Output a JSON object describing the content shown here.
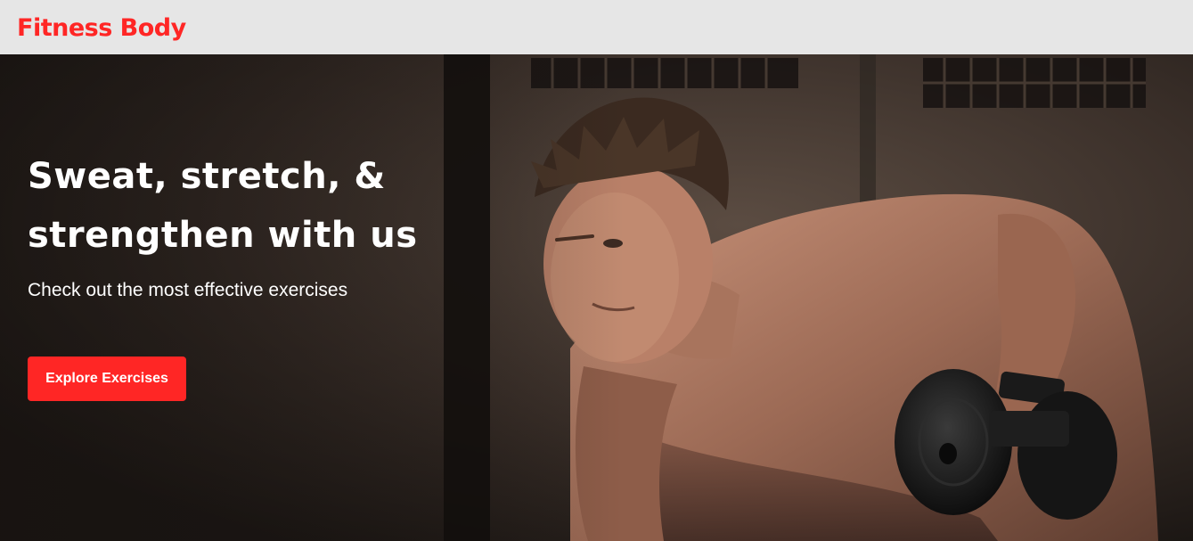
{
  "navbar": {
    "brand": "Fitness Body"
  },
  "hero": {
    "headline_line1": "Sweat, stretch, &",
    "headline_line2": "strengthen with us",
    "subtitle": "Check out the most effective exercises",
    "cta_label": "Explore Exercises",
    "image_subject": "man-lifting-dumbbell-photo"
  },
  "colors": {
    "brand_red": "#ff2625",
    "navbar_bg": "#e6e6e6",
    "text_light": "#ffffff"
  }
}
